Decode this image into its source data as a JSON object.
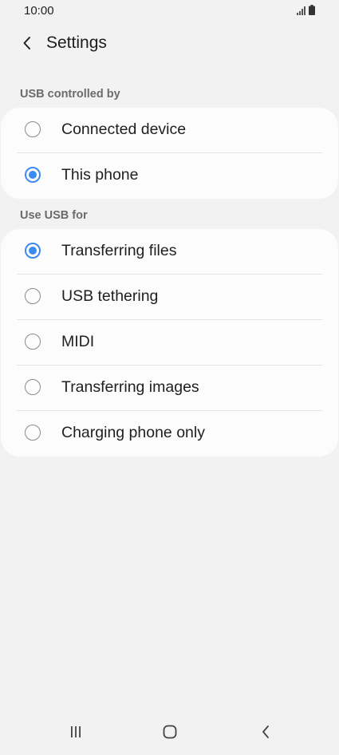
{
  "status_bar": {
    "time": "10:00"
  },
  "app_bar": {
    "title": "Settings",
    "back_icon": "chevron-left-icon"
  },
  "sections": [
    {
      "header": "USB controlled by",
      "options": [
        {
          "label": "Connected device",
          "selected": false
        },
        {
          "label": "This phone",
          "selected": true
        }
      ]
    },
    {
      "header": "Use USB for",
      "options": [
        {
          "label": "Transferring files",
          "selected": true
        },
        {
          "label": "USB tethering",
          "selected": false
        },
        {
          "label": "MIDI",
          "selected": false
        },
        {
          "label": "Transferring images",
          "selected": false
        },
        {
          "label": "Charging phone only",
          "selected": false
        }
      ]
    }
  ],
  "nav_bar": {
    "icons": [
      "recent-apps-icon",
      "home-icon",
      "back-icon"
    ]
  },
  "colors": {
    "background": "#f2f2f2",
    "card": "#fcfcfc",
    "accent": "#3e8af3",
    "section_header": "#6b6b6b"
  }
}
